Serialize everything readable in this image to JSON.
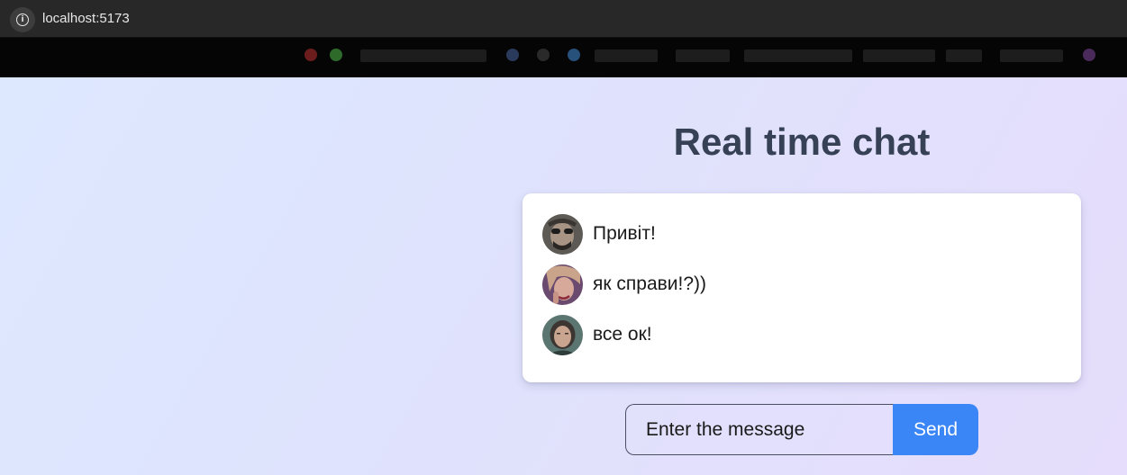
{
  "browser": {
    "url": "localhost:5173",
    "info_icon": "info-icon"
  },
  "chat": {
    "title": "Real time chat",
    "messages": [
      {
        "text": "Привіт!",
        "avatar": "avatar-1"
      },
      {
        "text": "як справи!?))",
        "avatar": "avatar-2"
      },
      {
        "text": "все ок!",
        "avatar": "avatar-3"
      }
    ],
    "input_placeholder": "Enter the message",
    "send_label": "Send"
  },
  "colors": {
    "accent": "#3b86f7",
    "title": "#374155",
    "background_start": "#dde8ff",
    "background_end": "#e5ddfb"
  }
}
